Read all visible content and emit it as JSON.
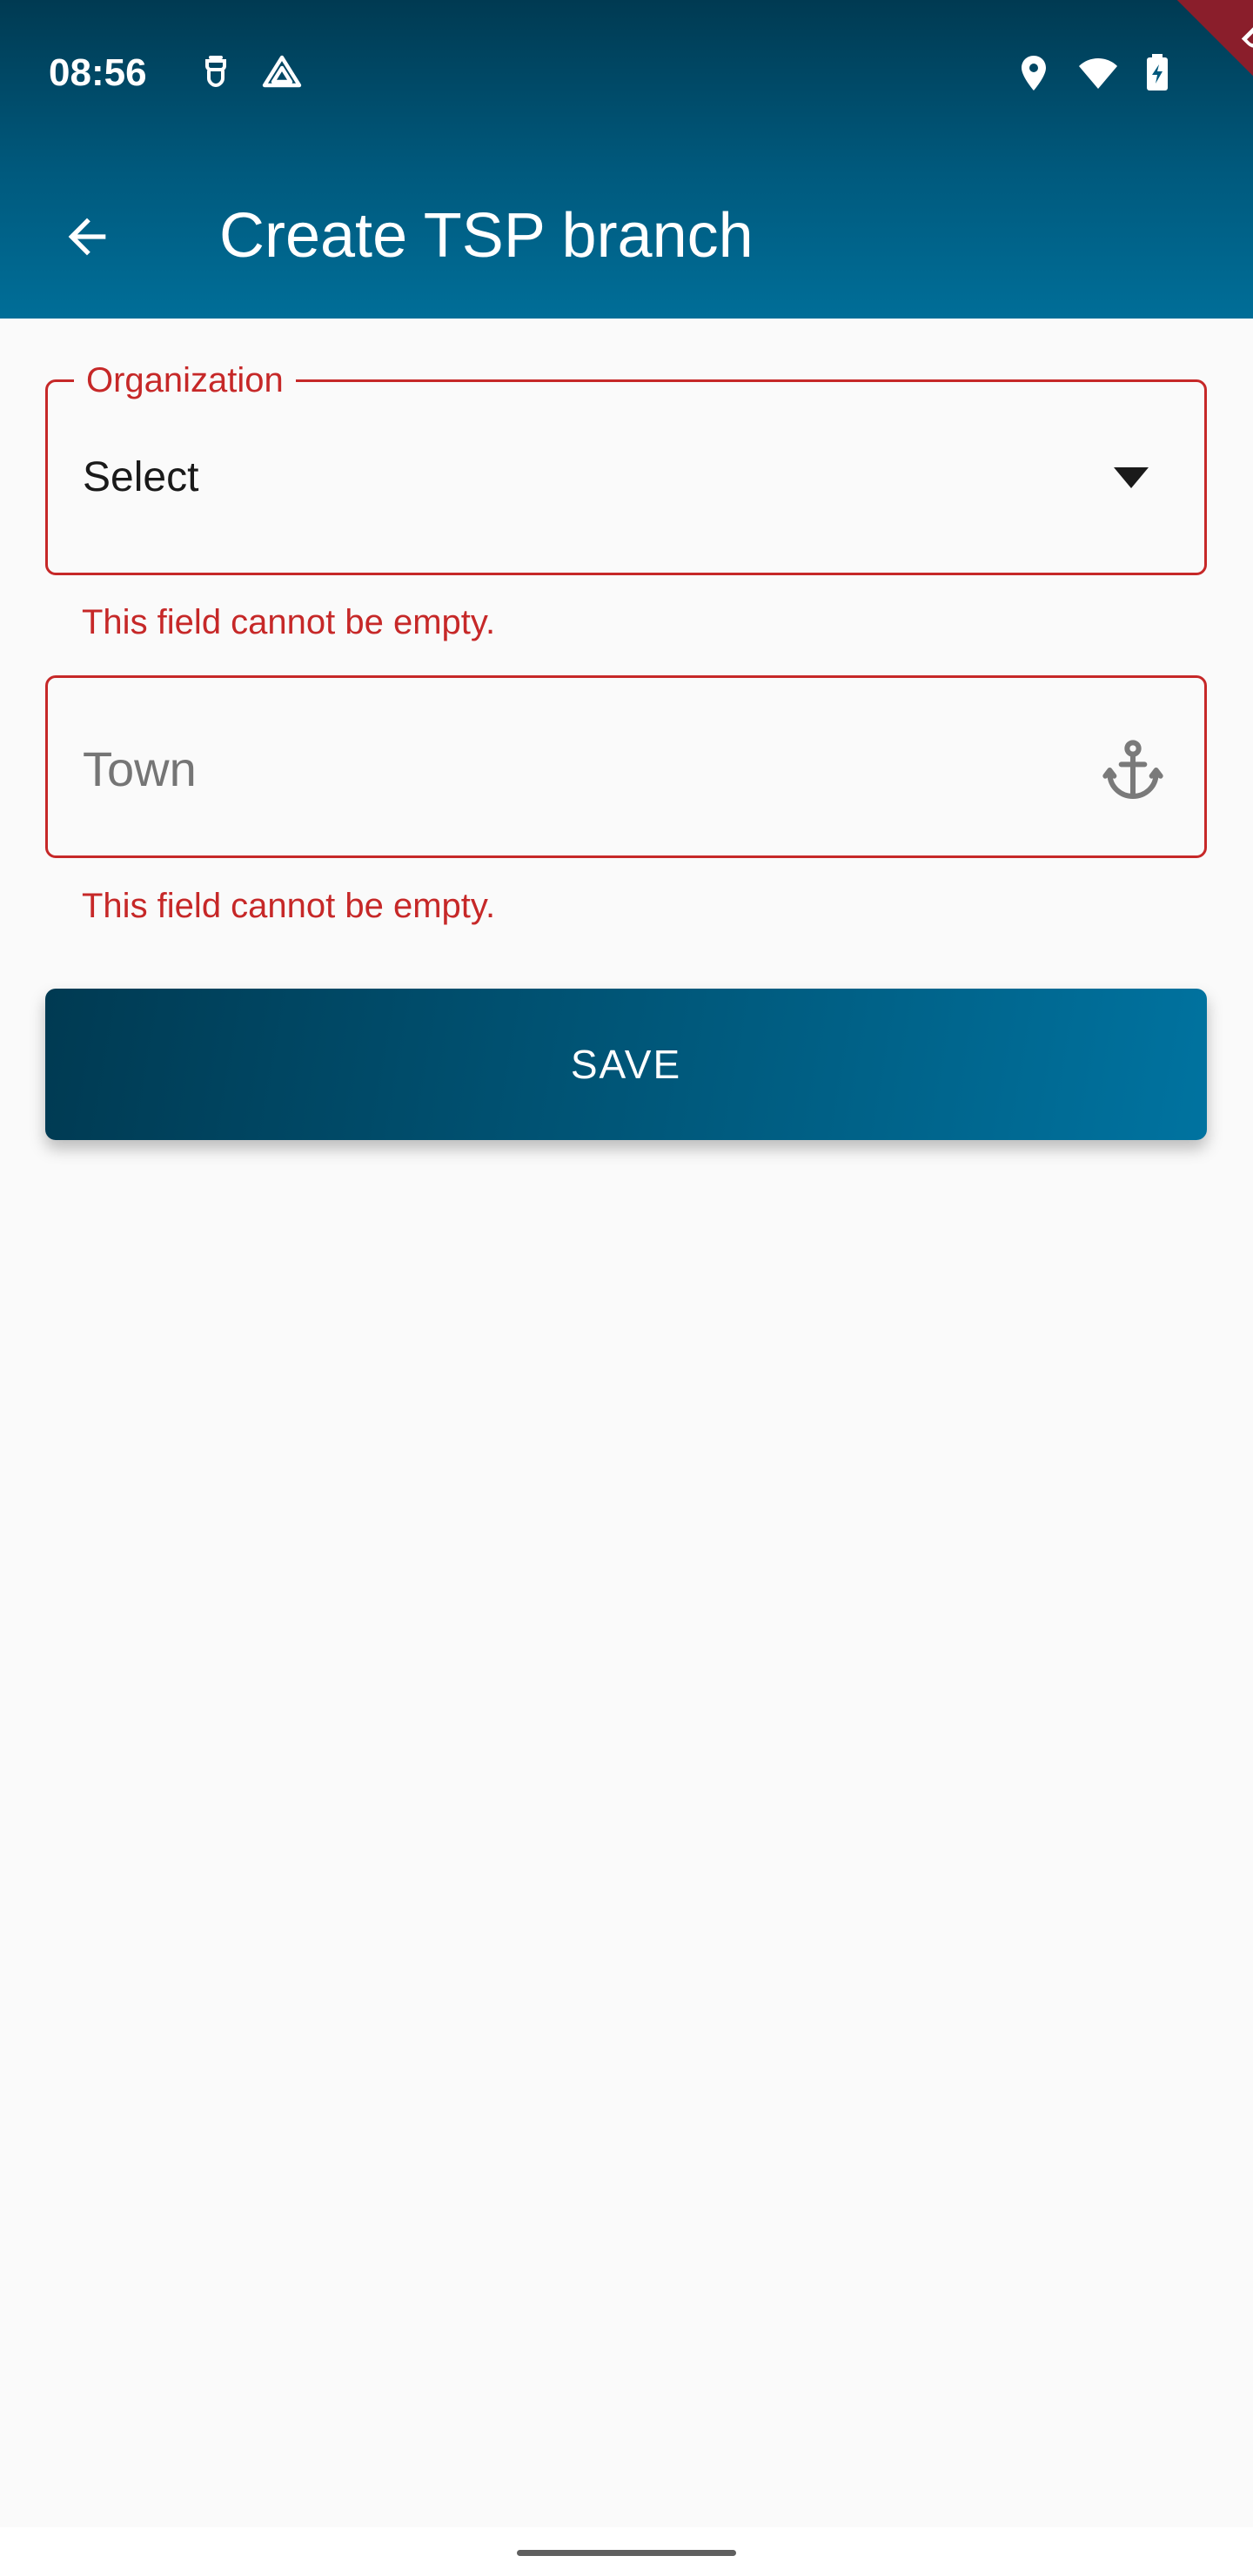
{
  "status_bar": {
    "time": "08:56",
    "icons": [
      "notification-app-icon",
      "drive-icon",
      "location-icon",
      "wifi-icon",
      "battery-charging-icon"
    ]
  },
  "debug_banner": {
    "label": "DEBUG"
  },
  "app_bar": {
    "title": "Create TSP branch",
    "back_icon": "arrow-back-icon"
  },
  "form": {
    "organization": {
      "label": "Organization",
      "value": "Select",
      "icon": "dropdown-arrow-icon",
      "error": "This field cannot be empty."
    },
    "town": {
      "placeholder": "Town",
      "icon": "anchor-icon",
      "error": "This field cannot be empty."
    },
    "save_label": "SAVE"
  },
  "colors": {
    "primary": "#005a7e",
    "primary_dark": "#003a52",
    "error": "#c62828",
    "background": "#fafafa"
  }
}
